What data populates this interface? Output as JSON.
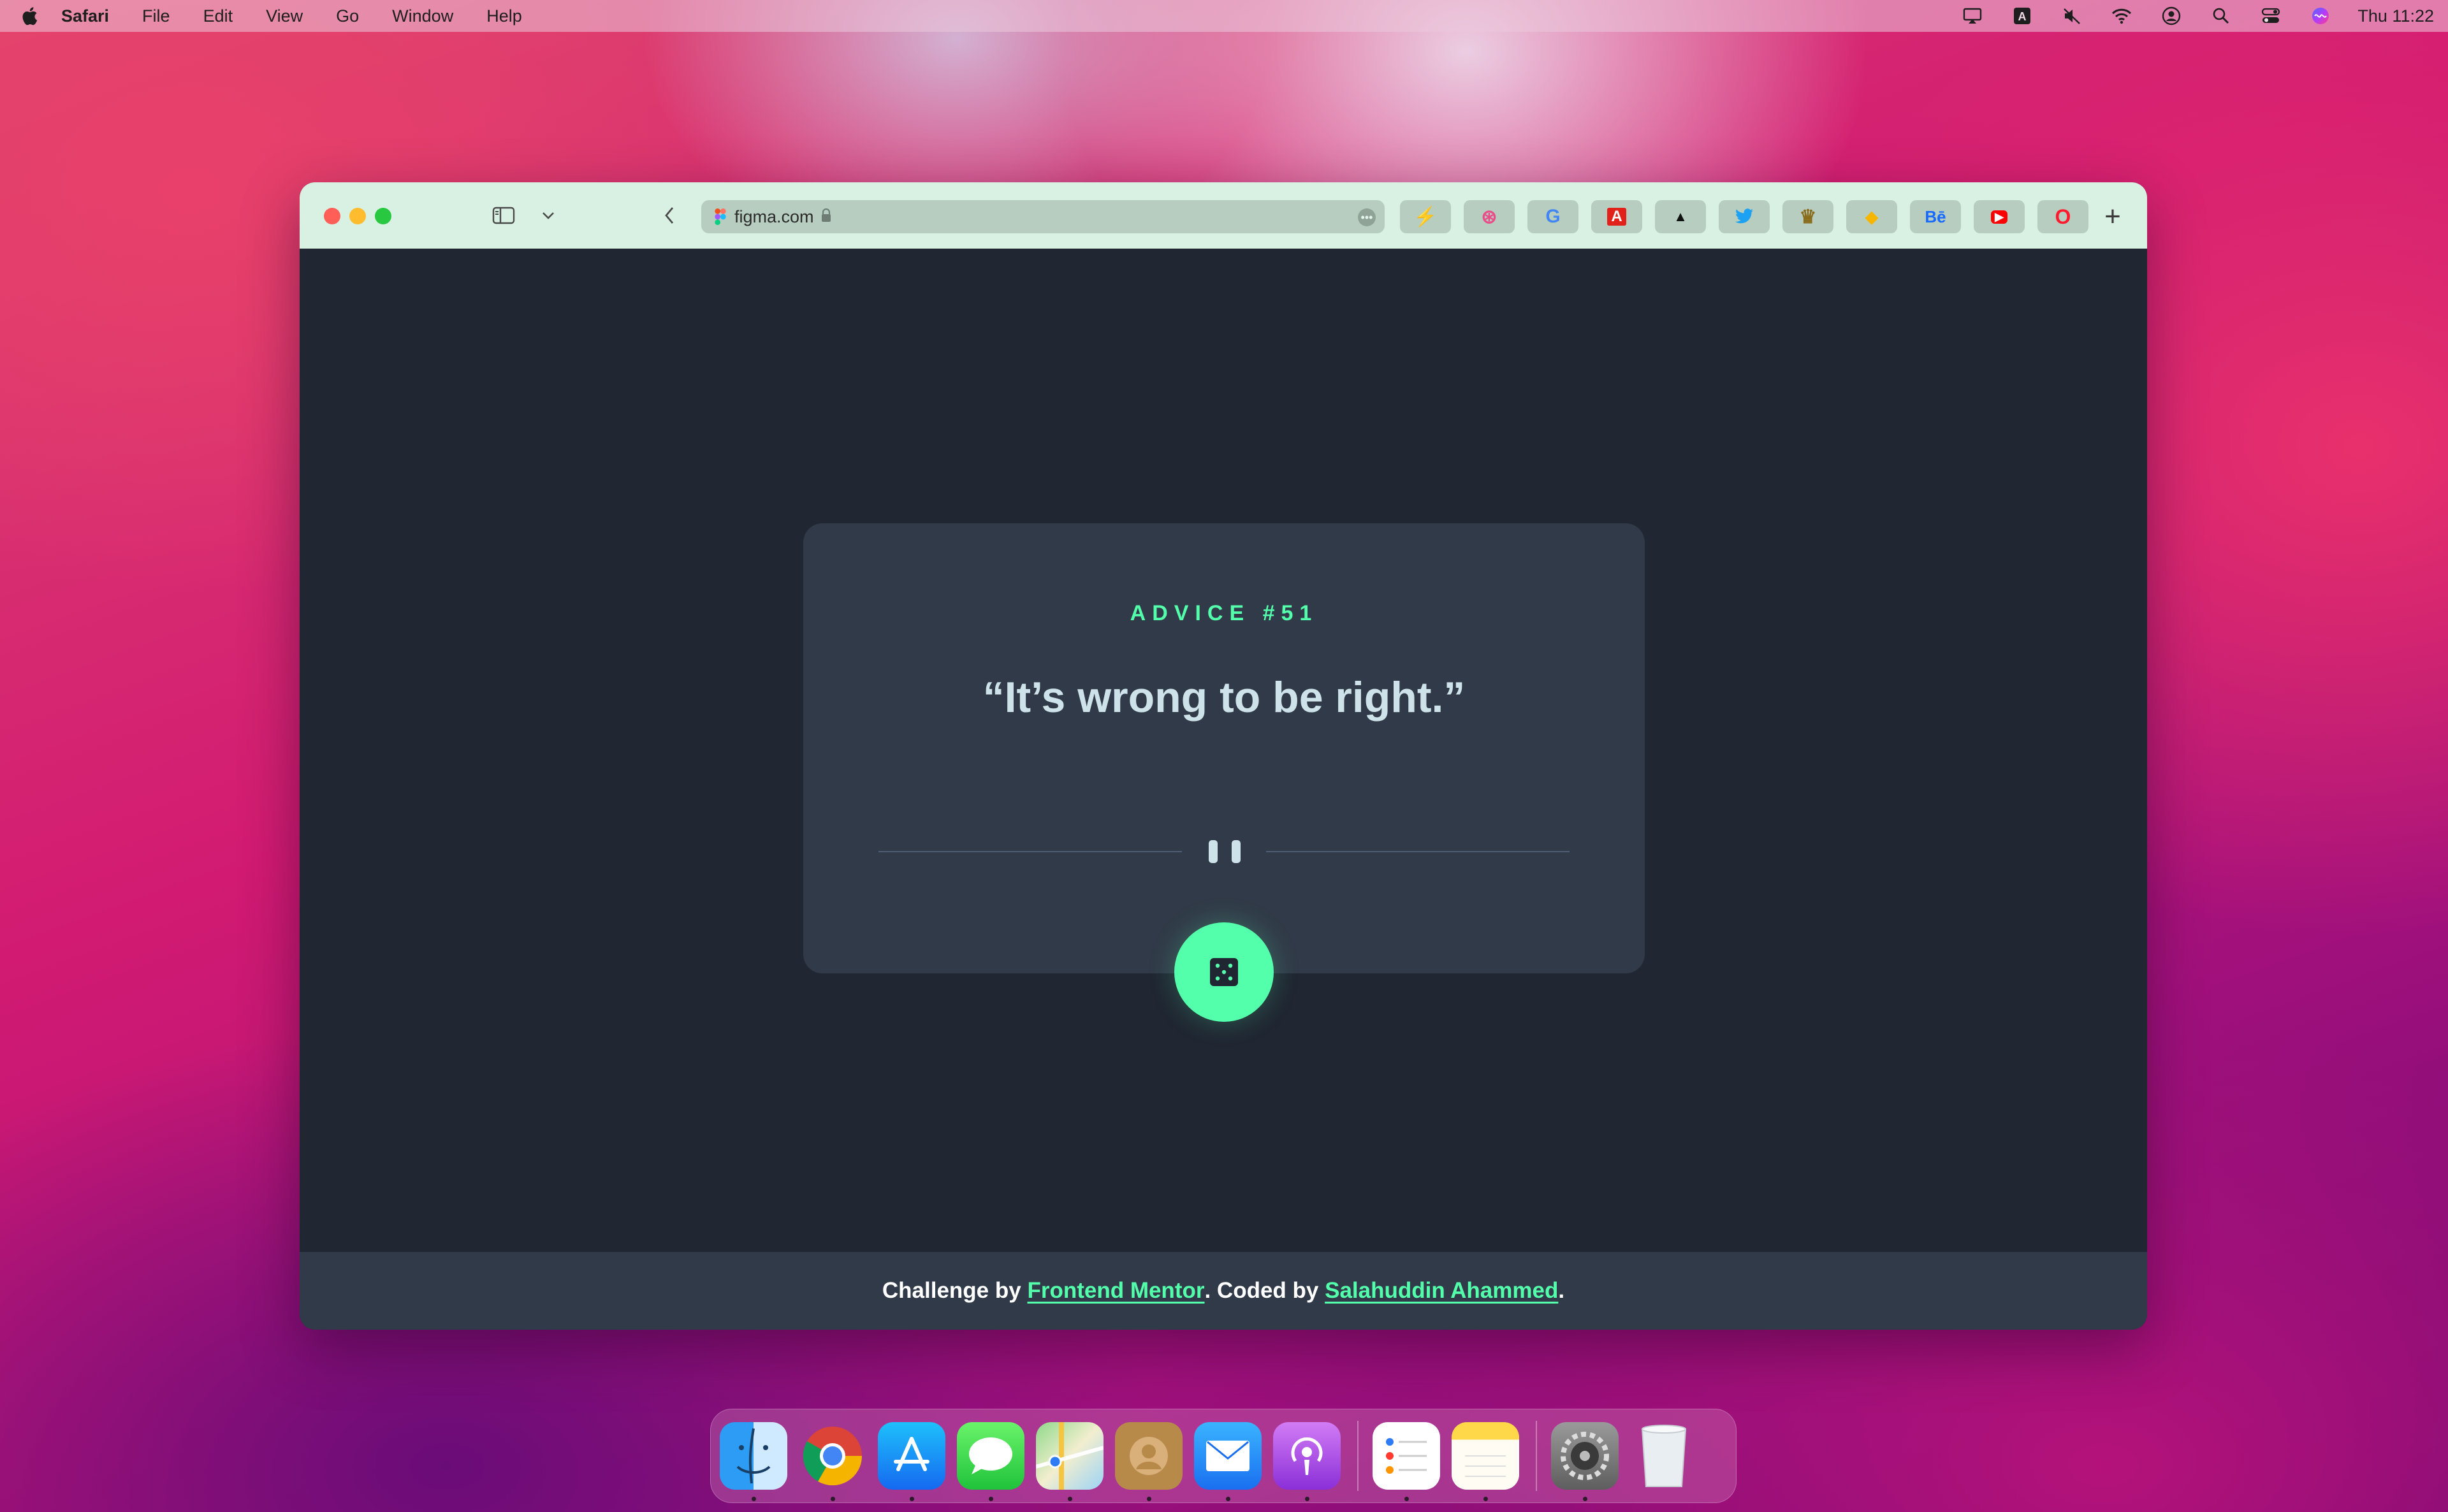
{
  "menubar": {
    "app_name": "Safari",
    "menus": [
      "File",
      "Edit",
      "View",
      "Go",
      "Window",
      "Help"
    ],
    "clock": "Thu 11:22",
    "status_icons": [
      "airplay-icon",
      "input-source-icon",
      "mute-icon",
      "wifi-icon",
      "user-icon",
      "spotlight-icon",
      "control-center-icon",
      "siri-icon"
    ]
  },
  "browser": {
    "url": "figma.com",
    "url_more": "•••",
    "new_tab": "+",
    "favorites": [
      {
        "name": "bolt-favorite",
        "glyph": "⚡",
        "color": "#f2b705"
      },
      {
        "name": "dribbble-favorite",
        "glyph": "⊛",
        "color": "#ea4c89"
      },
      {
        "name": "google-favorite",
        "glyph": "G",
        "color": "#4285f4"
      },
      {
        "name": "adobe-favorite",
        "glyph": "A",
        "color": "#e0221b"
      },
      {
        "name": "adidas-favorite",
        "glyph": "▲",
        "color": "#111111"
      },
      {
        "name": "twitter-favorite",
        "glyph": "🐦",
        "color": "#1da1f2"
      },
      {
        "name": "crown-favorite",
        "glyph": "♛",
        "color": "#8a6d1c"
      },
      {
        "name": "sketch-favorite",
        "glyph": "◆",
        "color": "#f6b600"
      },
      {
        "name": "behance-favorite",
        "glyph": "Bē",
        "color": "#1769ff"
      },
      {
        "name": "youtube-favorite",
        "glyph": "▶",
        "color": "#ff0000"
      },
      {
        "name": "opera-favorite",
        "glyph": "O",
        "color": "#ff1b2d"
      }
    ]
  },
  "advice": {
    "id_label": "ADVICE #51",
    "quote": "“It’s wrong to be right.”"
  },
  "footer": {
    "prefix": "Challenge by ",
    "link1": "Frontend Mentor",
    "middle": ". Coded by ",
    "link2": "Salahuddin Ahammed",
    "suffix": "."
  },
  "colors": {
    "accent": "#53ffaa",
    "card": "#313a48",
    "page": "#202632",
    "quote_text": "#cee3e9"
  },
  "dock": {
    "apps": [
      "finder-icon",
      "chrome-icon",
      "app-store-icon",
      "messages-icon",
      "maps-icon",
      "contacts-icon",
      "mail-icon",
      "podcasts-icon",
      "reminders-icon",
      "notes-icon",
      "system-preferences-icon",
      "trash-icon"
    ]
  }
}
